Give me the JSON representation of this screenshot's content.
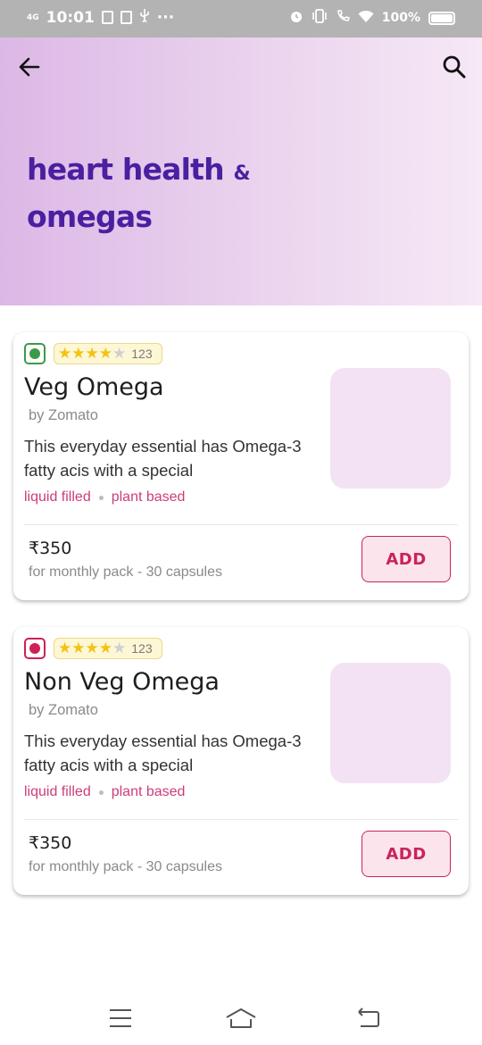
{
  "status_bar": {
    "network": "4G",
    "time": "10:01",
    "more": "···",
    "battery": "100%"
  },
  "header": {
    "title_line1": "heart health",
    "title_amp": "&",
    "title_line2": "omegas"
  },
  "products": [
    {
      "diet": "veg",
      "rating": 4,
      "rating_max": 5,
      "rating_count": "123",
      "name": "Veg Omega",
      "brand": "by Zomato",
      "description": "This everyday essential has Omega-3 fatty acis with a special",
      "tags": [
        "liquid filled",
        "plant based"
      ],
      "price": "₹350",
      "price_note": "for monthly pack - 30 capsules",
      "add_label": "ADD"
    },
    {
      "diet": "non-veg",
      "rating": 4,
      "rating_max": 5,
      "rating_count": "123",
      "name": "Non Veg Omega",
      "brand": "by Zomato",
      "description": "This everyday essential has Omega-3 fatty acis with a special",
      "tags": [
        "liquid filled",
        "plant based"
      ],
      "price": "₹350",
      "price_note": "for monthly pack - 30 capsules",
      "add_label": "ADD"
    }
  ],
  "colors": {
    "title": "#4a1fa0",
    "accent": "#c8245a",
    "veg": "#3a9a4a",
    "non_veg": "#cc2255",
    "star": "#f2c311"
  },
  "icons": {
    "back": "arrow-left-icon",
    "search": "search-icon",
    "nav_menu": "menu-icon",
    "nav_home": "home-icon",
    "nav_back": "back-icon"
  }
}
